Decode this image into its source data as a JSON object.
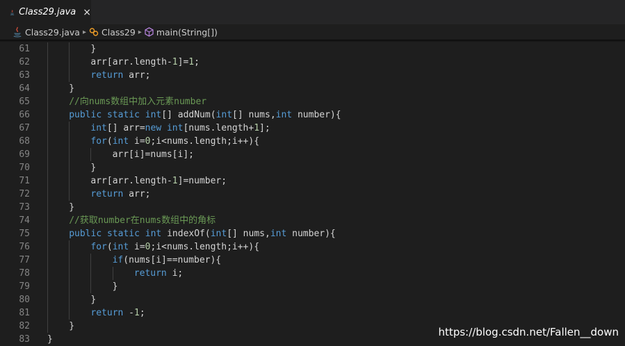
{
  "tab": {
    "title": "Class29.java",
    "close": "×"
  },
  "breadcrumb": {
    "file": "Class29.java",
    "class": "Class29",
    "method": "main(String[])"
  },
  "watermark": "https://blog.csdn.net/Fallen__down",
  "colors": {
    "keyword": "#569cd6",
    "comment": "#6a9955",
    "number": "#b5cea8",
    "text": "#d4d4d4",
    "line_number": "#858585"
  },
  "lines": [
    {
      "n": "61",
      "indent": 2,
      "tokens": [
        [
          "t",
          "}"
        ]
      ]
    },
    {
      "n": "62",
      "indent": 2,
      "tokens": [
        [
          "t",
          "arr[arr.length-"
        ],
        [
          "n",
          "1"
        ],
        [
          "t",
          "]="
        ],
        [
          "n",
          "1"
        ],
        [
          "t",
          ";"
        ]
      ]
    },
    {
      "n": "63",
      "indent": 2,
      "tokens": [
        [
          "k",
          "return"
        ],
        [
          "t",
          " arr;"
        ]
      ]
    },
    {
      "n": "64",
      "indent": 1,
      "tokens": [
        [
          "t",
          "}"
        ]
      ]
    },
    {
      "n": "65",
      "indent": 1,
      "tokens": [
        [
          "c",
          "//向nums数组中加入元素number"
        ]
      ]
    },
    {
      "n": "66",
      "indent": 1,
      "tokens": [
        [
          "k",
          "public"
        ],
        [
          "t",
          " "
        ],
        [
          "k",
          "static"
        ],
        [
          "t",
          " "
        ],
        [
          "k",
          "int"
        ],
        [
          "t",
          "[] addNum("
        ],
        [
          "k",
          "int"
        ],
        [
          "t",
          "[] nums,"
        ],
        [
          "k",
          "int"
        ],
        [
          "t",
          " number){"
        ]
      ]
    },
    {
      "n": "67",
      "indent": 2,
      "tokens": [
        [
          "k",
          "int"
        ],
        [
          "t",
          "[] arr="
        ],
        [
          "k",
          "new"
        ],
        [
          "t",
          " "
        ],
        [
          "k",
          "int"
        ],
        [
          "t",
          "[nums.length+"
        ],
        [
          "n",
          "1"
        ],
        [
          "t",
          "];"
        ]
      ]
    },
    {
      "n": "68",
      "indent": 2,
      "tokens": [
        [
          "k",
          "for"
        ],
        [
          "t",
          "("
        ],
        [
          "k",
          "int"
        ],
        [
          "t",
          " i="
        ],
        [
          "n",
          "0"
        ],
        [
          "t",
          ";i<nums.length;i++){"
        ]
      ]
    },
    {
      "n": "69",
      "indent": 3,
      "tokens": [
        [
          "t",
          "arr[i]=nums[i];"
        ]
      ]
    },
    {
      "n": "70",
      "indent": 2,
      "tokens": [
        [
          "t",
          "}"
        ]
      ]
    },
    {
      "n": "71",
      "indent": 2,
      "tokens": [
        [
          "t",
          "arr[arr.length-"
        ],
        [
          "n",
          "1"
        ],
        [
          "t",
          "]=number;"
        ]
      ]
    },
    {
      "n": "72",
      "indent": 2,
      "tokens": [
        [
          "k",
          "return"
        ],
        [
          "t",
          " arr;"
        ]
      ]
    },
    {
      "n": "73",
      "indent": 1,
      "tokens": [
        [
          "t",
          "}"
        ]
      ]
    },
    {
      "n": "74",
      "indent": 1,
      "tokens": [
        [
          "c",
          "//获取number在nums数组中的角标"
        ]
      ]
    },
    {
      "n": "75",
      "indent": 1,
      "tokens": [
        [
          "k",
          "public"
        ],
        [
          "t",
          " "
        ],
        [
          "k",
          "static"
        ],
        [
          "t",
          " "
        ],
        [
          "k",
          "int"
        ],
        [
          "t",
          " indexOf("
        ],
        [
          "k",
          "int"
        ],
        [
          "t",
          "[] nums,"
        ],
        [
          "k",
          "int"
        ],
        [
          "t",
          " number){"
        ]
      ]
    },
    {
      "n": "76",
      "indent": 2,
      "tokens": [
        [
          "k",
          "for"
        ],
        [
          "t",
          "("
        ],
        [
          "k",
          "int"
        ],
        [
          "t",
          " i="
        ],
        [
          "n",
          "0"
        ],
        [
          "t",
          ";i<nums.length;i++){"
        ]
      ]
    },
    {
      "n": "77",
      "indent": 3,
      "tokens": [
        [
          "k",
          "if"
        ],
        [
          "t",
          "(nums[i]==number){"
        ]
      ]
    },
    {
      "n": "78",
      "indent": 4,
      "tokens": [
        [
          "k",
          "return"
        ],
        [
          "t",
          " i;"
        ]
      ]
    },
    {
      "n": "79",
      "indent": 3,
      "tokens": [
        [
          "t",
          "}"
        ]
      ]
    },
    {
      "n": "80",
      "indent": 2,
      "tokens": [
        [
          "t",
          "}"
        ]
      ]
    },
    {
      "n": "81",
      "indent": 2,
      "tokens": [
        [
          "k",
          "return"
        ],
        [
          "t",
          " -"
        ],
        [
          "n",
          "1"
        ],
        [
          "t",
          ";"
        ]
      ]
    },
    {
      "n": "82",
      "indent": 1,
      "tokens": [
        [
          "t",
          "}"
        ]
      ]
    },
    {
      "n": "83",
      "indent": 0,
      "tokens": [
        [
          "t",
          "}"
        ]
      ]
    }
  ]
}
